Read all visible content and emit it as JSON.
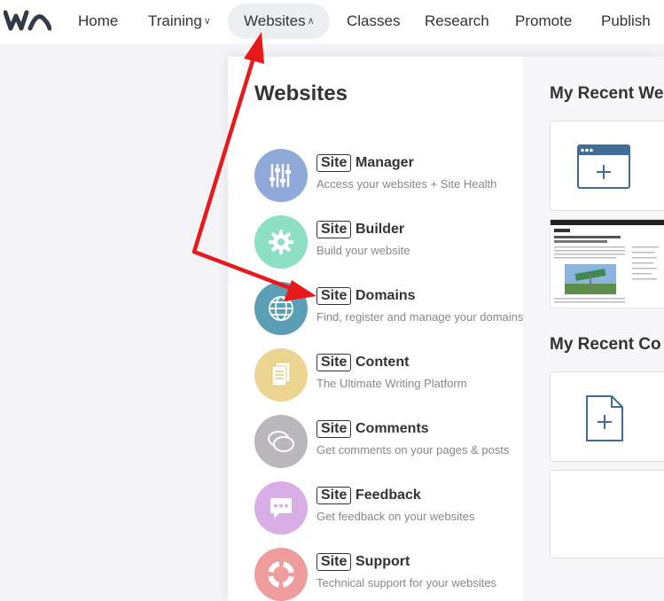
{
  "nav": {
    "items": [
      {
        "label": "Home",
        "caret": ""
      },
      {
        "label": "Training",
        "caret": "∨"
      },
      {
        "label": "Websites",
        "caret": "∧"
      },
      {
        "label": "Classes",
        "caret": ""
      },
      {
        "label": "Research",
        "caret": ""
      },
      {
        "label": "Promote",
        "caret": ""
      },
      {
        "label": "Publish",
        "caret": ""
      }
    ],
    "active": "Websites"
  },
  "panel": {
    "title": "Websites",
    "tag": "Site",
    "items": [
      {
        "name": "Manager",
        "desc": "Access your websites + Site Health",
        "color": "#8fa9d8",
        "icon": "sliders-icon"
      },
      {
        "name": "Builder",
        "desc": "Build your website",
        "color": "#8ee0c4",
        "icon": "gear-icon"
      },
      {
        "name": "Domains",
        "desc": "Find, register and manage your domains",
        "color": "#5a9fb5",
        "icon": "globe-icon"
      },
      {
        "name": "Content",
        "desc": "The Ultimate Writing Platform",
        "color": "#ecd590",
        "icon": "document-icon"
      },
      {
        "name": "Comments",
        "desc": "Get comments on your pages & posts",
        "color": "#b9b7bb",
        "icon": "chat-bubbles-icon"
      },
      {
        "name": "Feedback",
        "desc": "Get feedback on your websites",
        "color": "#d9aee6",
        "icon": "feedback-bubble-icon"
      },
      {
        "name": "Support",
        "desc": "Technical support for your websites",
        "color": "#ee9c9c",
        "icon": "lifebuoy-icon"
      }
    ]
  },
  "right": {
    "recent_websites_title": "My Recent We",
    "recent_content_title": "My Recent Co",
    "new_site_icon": "browser-plus-icon",
    "new_doc_icon": "document-plus-icon",
    "accent": "#3f6d96"
  },
  "annotation": {
    "arrow_color": "#e8191b"
  }
}
